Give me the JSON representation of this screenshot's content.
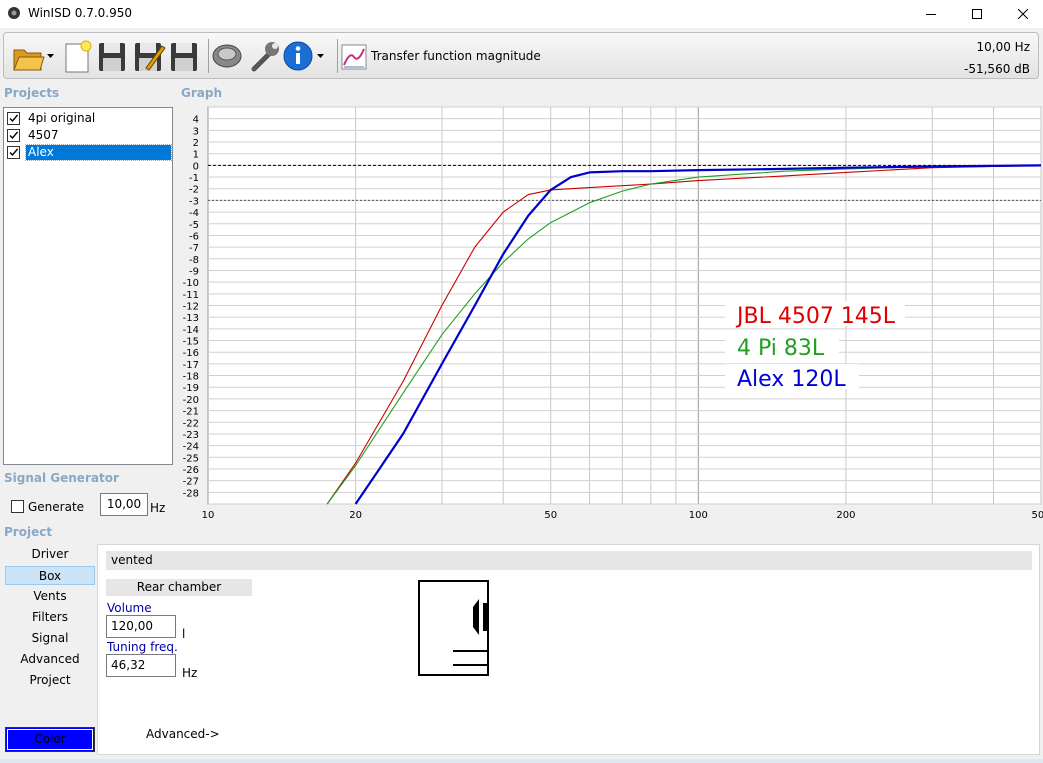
{
  "window": {
    "title": "WinISD 0.7.0.950"
  },
  "toolbar": {
    "plot_mode_label": "Transfer function magnitude",
    "cursor_freq": "10,00 Hz",
    "cursor_db": "-51,560 dB"
  },
  "projects": {
    "header": "Projects",
    "items": [
      {
        "label": "4pi original",
        "checked": true,
        "selected": false
      },
      {
        "label": "4507",
        "checked": true,
        "selected": false
      },
      {
        "label": "Alex",
        "checked": true,
        "selected": true
      }
    ]
  },
  "graph": {
    "header": "Graph",
    "annotations": [
      {
        "text": "JBL  4507  145L",
        "color": "#e00000"
      },
      {
        "text": "4 Pi  83L",
        "color": "#20a020"
      },
      {
        "text": "Alex  120L",
        "color": "#0000dd"
      }
    ]
  },
  "chart_data": {
    "type": "line",
    "xscale": "log",
    "xlim": [
      10,
      500
    ],
    "ylim": [
      -29,
      5
    ],
    "x_tick_labels": [
      "10",
      "20",
      "50",
      "100",
      "200",
      "500"
    ],
    "y_tick_labels": [
      "4",
      "3",
      "2",
      "1",
      "0",
      "-1",
      "-2",
      "-3",
      "-4",
      "-5",
      "-6",
      "-7",
      "-8",
      "-9",
      "-10",
      "-11",
      "-12",
      "-13",
      "-14",
      "-15",
      "-16",
      "-17",
      "-18",
      "-19",
      "-20",
      "-21",
      "-22",
      "-23",
      "-24",
      "-25",
      "-26",
      "-27",
      "-28"
    ],
    "reference_lines": [
      0,
      -3
    ],
    "grid": true,
    "series": [
      {
        "color": "#cc0000",
        "x": [
          17.5,
          20,
          25,
          30,
          35,
          40,
          45,
          50,
          60,
          80,
          100,
          150,
          200,
          300,
          500
        ],
        "y": [
          -29,
          -25.5,
          -18.5,
          -12,
          -7,
          -4,
          -2.5,
          -2.1,
          -1.9,
          -1.6,
          -1.3,
          -0.9,
          -0.6,
          -0.2,
          0
        ]
      },
      {
        "color": "#20a020",
        "x": [
          17.5,
          20,
          25,
          30,
          35,
          40,
          45,
          50,
          60,
          70,
          80,
          100,
          150,
          200,
          300,
          500
        ],
        "y": [
          -29,
          -25.7,
          -19.5,
          -14.5,
          -11,
          -8.3,
          -6.3,
          -4.9,
          -3.2,
          -2.2,
          -1.6,
          -1,
          -0.5,
          -0.3,
          -0.1,
          0
        ]
      },
      {
        "color": "#0000cc",
        "x": [
          20,
          25,
          30,
          35,
          40,
          45,
          50,
          55,
          60,
          70,
          80,
          100,
          150,
          200,
          300,
          500
        ],
        "y": [
          -29,
          -23,
          -17,
          -12,
          -7.6,
          -4.3,
          -2.1,
          -1,
          -0.6,
          -0.5,
          -0.5,
          -0.4,
          -0.3,
          -0.2,
          -0.1,
          0
        ]
      }
    ]
  },
  "signal_generator": {
    "header": "Signal Generator",
    "generate_label": "Generate",
    "generate_checked": false,
    "frequency_value": "10,00",
    "frequency_unit": "Hz"
  },
  "project_panel": {
    "header": "Project",
    "nav": [
      "Driver",
      "Box",
      "Vents",
      "Filters",
      "Signal",
      "Advanced",
      "Project"
    ],
    "active_nav": "Box",
    "color_button_label": "Color",
    "color_value": "#0000ff",
    "box_type": "vented",
    "rear_chamber_header": "Rear chamber",
    "volume_label": "Volume",
    "volume_value": "120,00",
    "volume_unit": "l",
    "tuning_label": "Tuning freq.",
    "tuning_value": "46,32",
    "tuning_unit": "Hz",
    "advanced_link": "Advanced->"
  }
}
